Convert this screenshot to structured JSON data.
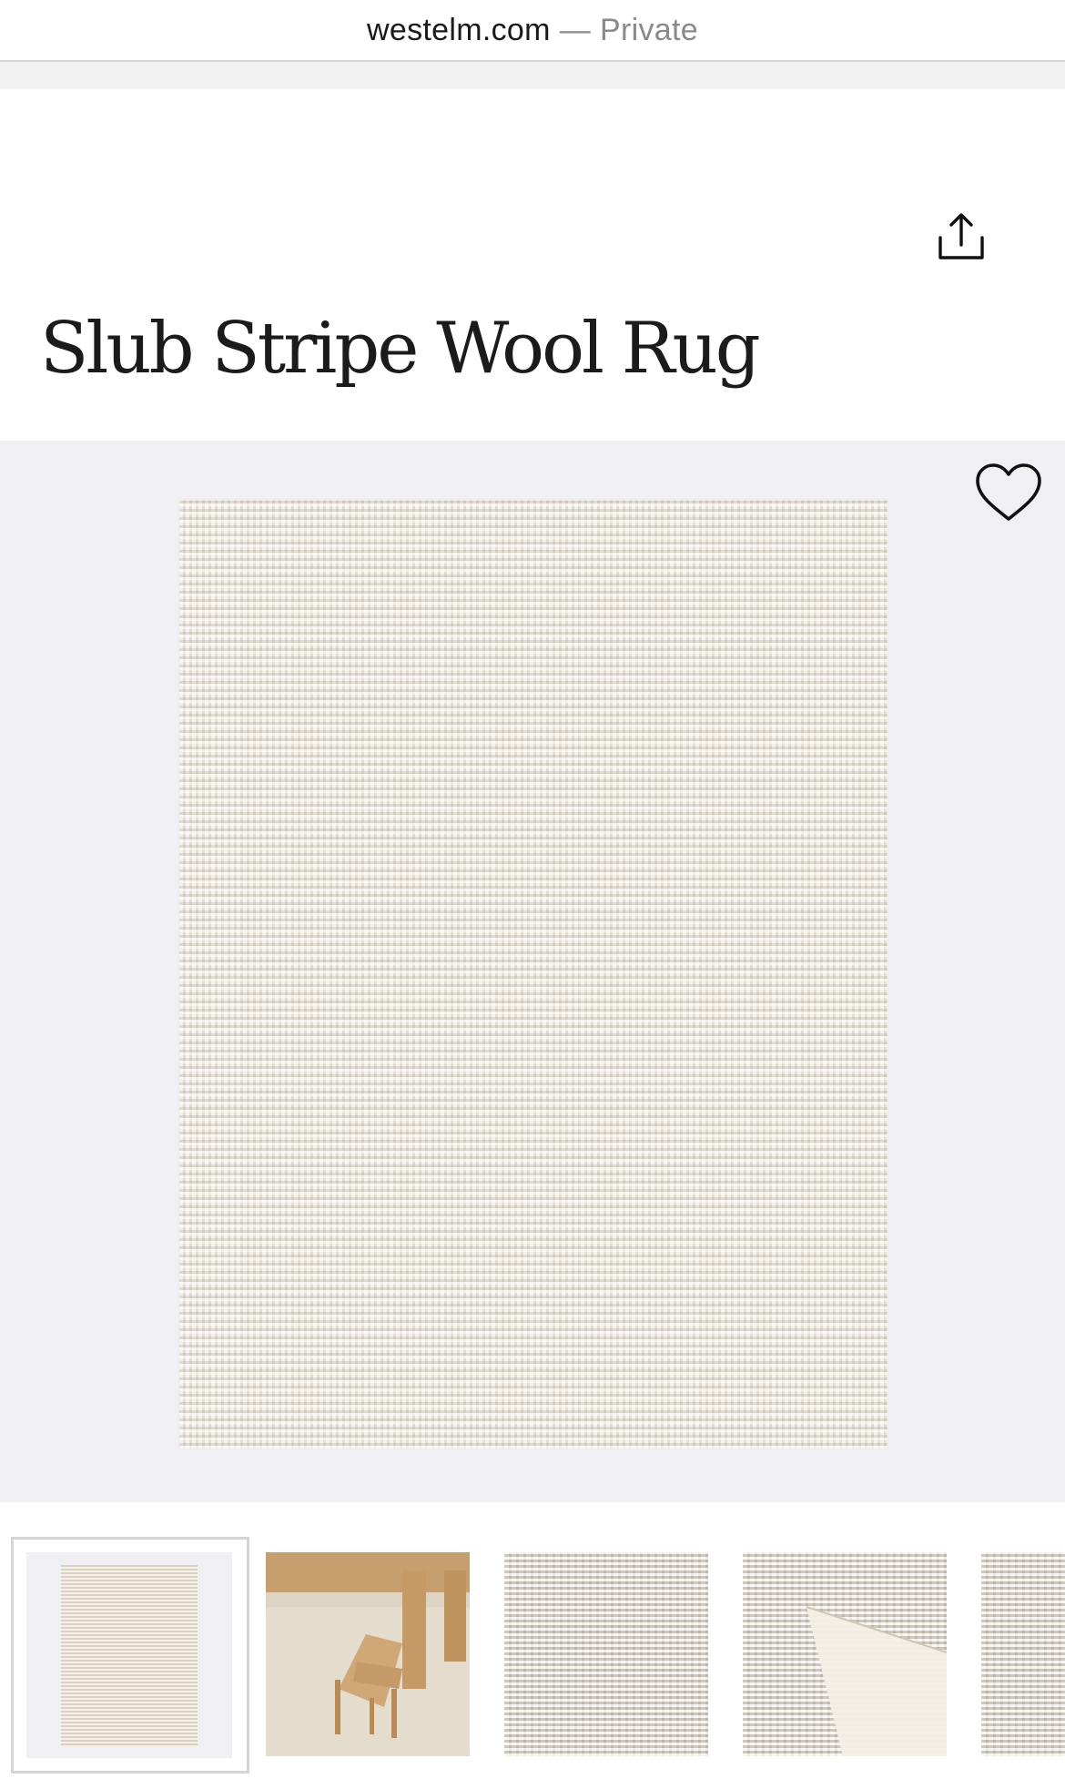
{
  "browser": {
    "domain": "westelm.com",
    "separator": "—",
    "mode": "Private"
  },
  "product": {
    "title": "Slub Stripe Wool Rug"
  },
  "icons": {
    "share": "share-icon",
    "favorite": "heart-icon"
  },
  "gallery": {
    "selected_index": 0,
    "thumbnail_count_visible": 5
  },
  "colors": {
    "hero_background": "#f0eff3",
    "rug": "#ece6da",
    "text": "#1b1b1b"
  }
}
